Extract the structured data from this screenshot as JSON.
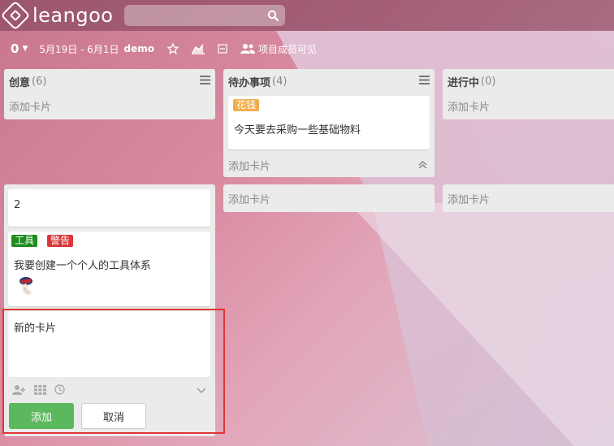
{
  "app": {
    "logo_text": "leangoo"
  },
  "search": {
    "placeholder": ""
  },
  "board": {
    "count": "0",
    "dates": "5月19日 - 6月1日",
    "name": "demo",
    "visibility": "项目成员可见"
  },
  "lists_top": [
    {
      "title": "创意",
      "count": "(6)",
      "add_card": "添加卡片"
    },
    {
      "title": "待办事项",
      "count": "(4)",
      "add_card": "添加卡片"
    },
    {
      "title": "进行中",
      "count": "(0)",
      "add_card": "添加卡片"
    }
  ],
  "todo_card": {
    "label": "花钱",
    "label_color": "#f0ad4e",
    "text": "今天要去采购一些基础物料"
  },
  "lists_bottom": [
    {
      "add_card": "添加卡片"
    },
    {
      "add_card": "添加卡片"
    }
  ],
  "card_two": {
    "text": "2"
  },
  "card_tools": {
    "labels": [
      {
        "text": "工具",
        "color": "#1e8c1e"
      },
      {
        "text": "警告",
        "color": "#d9373b"
      }
    ],
    "text": "我要创建一个个人的工具体系"
  },
  "new_card": {
    "text": "新的卡片",
    "add_label": "添加",
    "cancel_label": "取消"
  }
}
